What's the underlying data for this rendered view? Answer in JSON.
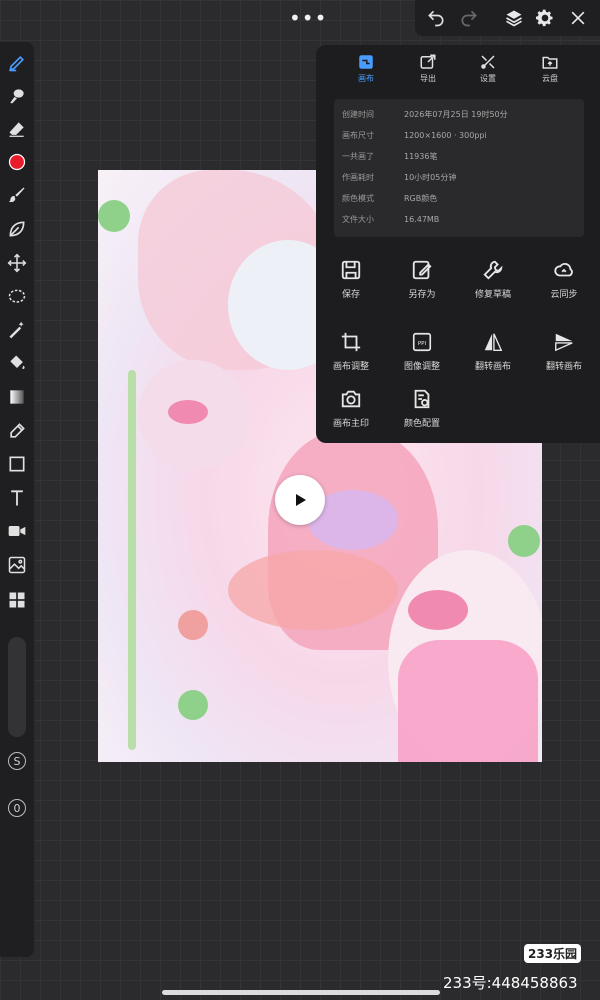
{
  "top_bar": {
    "more": "•••"
  },
  "panel": {
    "tabs": [
      {
        "label": "画布",
        "icon": "canvas-icon",
        "active": true
      },
      {
        "label": "导出",
        "icon": "export-icon",
        "active": false
      },
      {
        "label": "设置",
        "icon": "settings-tools-icon",
        "active": false
      },
      {
        "label": "云盘",
        "icon": "cloud-folder-icon",
        "active": false
      }
    ],
    "info": [
      {
        "key": "创建时间",
        "value": "2026年07月25日 19时50分"
      },
      {
        "key": "画布尺寸",
        "value": "1200×1600 · 300ppi"
      },
      {
        "key": "一共画了",
        "value": "11936笔"
      },
      {
        "key": "作画耗时",
        "value": "10小时05分钟"
      },
      {
        "key": "颜色模式",
        "value": "RGB颜色"
      },
      {
        "key": "文件大小",
        "value": "16.47MB"
      }
    ],
    "actions": [
      {
        "label": "保存",
        "icon": "save-icon"
      },
      {
        "label": "另存为",
        "icon": "save-as-icon"
      },
      {
        "label": "修复草稿",
        "icon": "repair-icon"
      },
      {
        "label": "云同步",
        "icon": "cloud-sync-icon"
      },
      {
        "label": "画布调整",
        "icon": "crop-icon"
      },
      {
        "label": "图像调整",
        "icon": "ppi-icon"
      },
      {
        "label": "翻转画布",
        "icon": "flip-horizontal-icon"
      },
      {
        "label": "翻转画布",
        "icon": "flip-vertical-icon"
      },
      {
        "label": "画布主印",
        "icon": "camera-icon"
      },
      {
        "label": "颜色配置",
        "icon": "color-profile-icon"
      }
    ]
  },
  "left_bar": {
    "s_label": "S",
    "o_label": "0",
    "brush_color": "#e81c2a"
  },
  "accent": "#4a9cff",
  "watermark": {
    "logo": "233乐园",
    "id": "233号:448458863"
  }
}
